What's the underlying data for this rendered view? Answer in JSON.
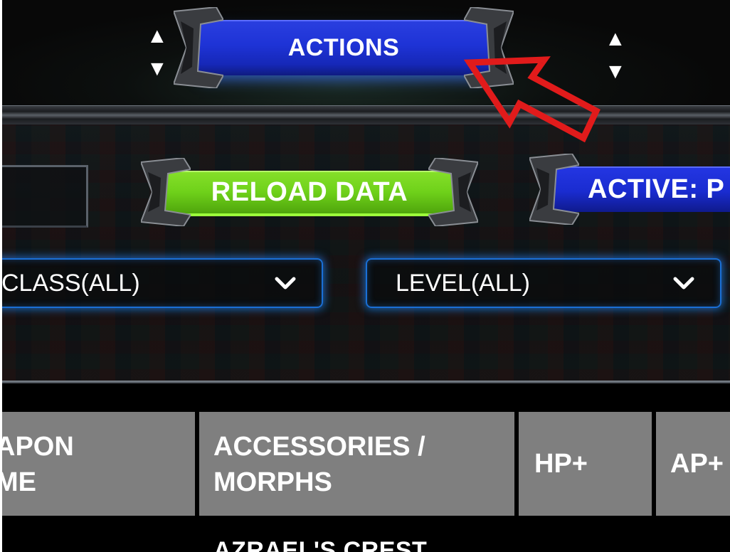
{
  "toolbar": {
    "actions_label": "ACTIONS",
    "reload_label": "RELOAD DATA",
    "active_label": "ACTIVE: P"
  },
  "filters": {
    "class_value": "CLASS(ALL)",
    "level_value": "LEVEL(ALL)"
  },
  "table": {
    "columns": [
      {
        "line1": "APON",
        "line2": "ME",
        "sortable": true
      },
      {
        "line1": "ACCESSORIES /",
        "line2": "MORPHS",
        "sortable": false
      },
      {
        "label": "HP+",
        "sortable": true
      },
      {
        "label": "AP+",
        "sortable": false
      }
    ],
    "sort_up": "▲",
    "sort_down": "▼",
    "first_row_text": "AZRAEL'S CREST"
  },
  "colors": {
    "actions_blue": "#1e33d6",
    "reload_green": "#6fd11a",
    "header_gray": "#7f7f7f",
    "dropdown_glow": "#1a6fd6",
    "annotation_red": "#e11b1b"
  },
  "icons": {
    "dropdown": "chevron-down-icon",
    "annotation": "red-arrow-icon"
  }
}
